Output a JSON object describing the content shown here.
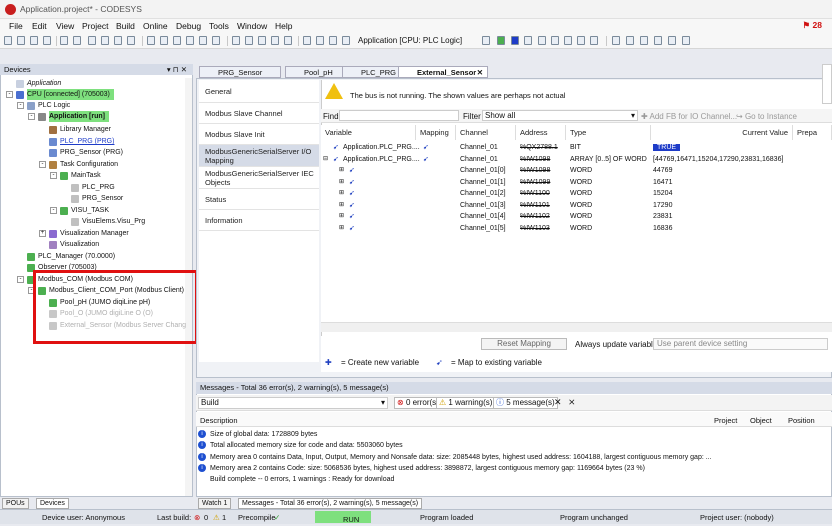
{
  "window": {
    "title": "Application.project* - CODESYS",
    "badge": "28"
  },
  "menu": [
    "File",
    "Edit",
    "View",
    "Project",
    "Build",
    "Online",
    "Debug",
    "Tools",
    "Window",
    "Help"
  ],
  "toolbar": {
    "app_selector": "Application [CPU: PLC Logic]"
  },
  "devices_panel": {
    "title": "Devices",
    "pin": "▾ ⊓ ✕"
  },
  "tree": [
    {
      "label": "Application",
      "exp": "",
      "ic": "#c8d0e0",
      "italic": true
    },
    {
      "label": "CPU [connected] (705003)",
      "exp": "-",
      "ic": "#4a6fd0",
      "hl": true
    },
    {
      "label": "PLC Logic",
      "exp": "-",
      "ic": "#8aa0c8"
    },
    {
      "label": "Application [run]",
      "exp": "-",
      "ic": "#888",
      "hl": true,
      "bold": true
    },
    {
      "label": "Library Manager",
      "exp": "",
      "ic": "#a07040"
    },
    {
      "label": "PLC_PRG (PRG)",
      "exp": "",
      "ic": "#6a8ad0",
      "link": true
    },
    {
      "label": "PRG_Sensor (PRG)",
      "exp": "",
      "ic": "#6a8ad0"
    },
    {
      "label": "Task Configuration",
      "exp": "-",
      "ic": "#b08040"
    },
    {
      "label": "MainTask",
      "exp": "-",
      "ic": "#4caf50"
    },
    {
      "label": "PLC_PRG",
      "exp": "",
      "ic": "#c0c0c0"
    },
    {
      "label": "PRG_Sensor",
      "exp": "",
      "ic": "#c0c0c0"
    },
    {
      "label": "VISU_TASK",
      "exp": "-",
      "ic": "#4caf50"
    },
    {
      "label": "VisuElems.Visu_Prg",
      "exp": "",
      "ic": "#c0c0c0"
    },
    {
      "label": "Visualization Manager",
      "exp": "+",
      "ic": "#8a6ad0"
    },
    {
      "label": "Visualization",
      "exp": "",
      "ic": "#a080c0"
    },
    {
      "label": "PLC_Manager (70.0000)",
      "exp": "",
      "ic": "#4caf50"
    },
    {
      "label": "Observer (705003)",
      "exp": "",
      "ic": "#4caf50"
    },
    {
      "label": "Modbus_COM (Modbus COM)",
      "exp": "-",
      "ic": "#4caf50"
    },
    {
      "label": "Modbus_Client_COM_Port (Modbus Client)",
      "exp": "-",
      "ic": "#4caf50"
    },
    {
      "label": "Pool_pH (JUMO diqiLine pH)",
      "exp": "",
      "ic": "#4caf50"
    },
    {
      "label": "Pool_O (JUMO digiLine O (O)",
      "exp": "",
      "ic": "#c8c8c8",
      "dim": true
    },
    {
      "label": "External_Sensor (Modbus Server Chang",
      "exp": "",
      "ic": "#c8c8c8",
      "dim": true
    }
  ],
  "bottom_tabs": {
    "pous": "POUs",
    "devices": "Devices"
  },
  "doc_tabs": [
    "PRG_Sensor",
    "Pool_pH",
    "PLC_PRG",
    "External_Sensor"
  ],
  "side_tabs": [
    "General",
    "Modbus Slave Channel",
    "Modbus Slave Init",
    "ModbusGenericSerialServer I/O Mapping",
    "ModbusGenericSerialServer IEC Objects",
    "Status",
    "Information"
  ],
  "warning": "The bus is not running. The shown values are perhaps not actual",
  "find": {
    "label": "Find",
    "filter_label": "Filter",
    "filter_value": "Show all",
    "add_fb": "Add FB for IO Channel...",
    "goto": "Go to Instance"
  },
  "grid": {
    "headers": [
      "Variable",
      "Mapping",
      "Channel",
      "Address",
      "Type",
      "Current Value",
      "Prepa"
    ],
    "rows": [
      {
        "var": "Application.PLC_PRG....",
        "map": "map",
        "chan": "Channel_01",
        "addr": "%QX2788.1",
        "type": "BIT",
        "val": "TRUE",
        "indent": 0,
        "exp": "",
        "true": true
      },
      {
        "var": "Application.PLC_PRG....",
        "map": "map",
        "chan": "Channel_01",
        "addr": "%IW1098",
        "type": "ARRAY [0..5] OF WORD",
        "val": "[44769,16471,15204,17290,23831,16836]",
        "indent": 0,
        "exp": "-"
      },
      {
        "var": "",
        "map": "",
        "chan": "Channel_01[0]",
        "addr": "%IW1098",
        "type": "WORD",
        "val": "44769",
        "indent": 1,
        "exp": "+"
      },
      {
        "var": "",
        "map": "",
        "chan": "Channel_01[1]",
        "addr": "%IW1099",
        "type": "WORD",
        "val": "16471",
        "indent": 1,
        "exp": "+"
      },
      {
        "var": "",
        "map": "",
        "chan": "Channel_01[2]",
        "addr": "%IW1100",
        "type": "WORD",
        "val": "15204",
        "indent": 1,
        "exp": "+"
      },
      {
        "var": "",
        "map": "",
        "chan": "Channel_01[3]",
        "addr": "%IW1101",
        "type": "WORD",
        "val": "17290",
        "indent": 1,
        "exp": "+"
      },
      {
        "var": "",
        "map": "",
        "chan": "Channel_01[4]",
        "addr": "%IW1102",
        "type": "WORD",
        "val": "23831",
        "indent": 1,
        "exp": "+"
      },
      {
        "var": "",
        "map": "",
        "chan": "Channel_01[5]",
        "addr": "%IW1103",
        "type": "WORD",
        "val": "16836",
        "indent": 1,
        "exp": "+"
      }
    ]
  },
  "reset": {
    "button": "Reset Mapping",
    "always_label": "Always update variables",
    "always_value": "Use parent device setting"
  },
  "legend": {
    "create": "= Create new variable",
    "map": "= Map to existing variable"
  },
  "messages": {
    "title": "Messages - Total 36 error(s), 2 warning(s), 5 message(s)",
    "source": "Build",
    "errors": "0 error(s)",
    "warnings": "1 warning(s)",
    "msgs": "5 message(s)",
    "cols": [
      "Description",
      "Project",
      "Object",
      "Position"
    ],
    "rows": [
      "Size of global data: 1728809 bytes",
      "Total allocated memory size for code and data: 5503060 bytes",
      "Memory area 0 contains Data, Input, Output, Memory and Nonsafe data: size: 2085448 bytes, highest used address: 1604188, largest contiguous memory gap: ...",
      "Memory area 2 contains Code: size: 5068536 bytes, highest used address: 3898872, largest contiguous memory gap: 1169664 bytes (23 %)",
      "Build complete -- 0 errors, 1 warnings : Ready for download"
    ]
  },
  "bottom_doc_tabs": {
    "watch": "Watch 1",
    "messages": "Messages - Total 36 error(s), 2 warning(s), 5 message(s)"
  },
  "status": {
    "device_user": "Device user: Anonymous",
    "last_build": "Last build:",
    "err_count": "0",
    "warn_count": "1",
    "precompile": "Precompile",
    "precompile_mark": "✓",
    "run": "RUN",
    "program_loaded": "Program loaded",
    "program_unchanged": "Program unchanged",
    "project_user": "Project user: (nobody)"
  }
}
